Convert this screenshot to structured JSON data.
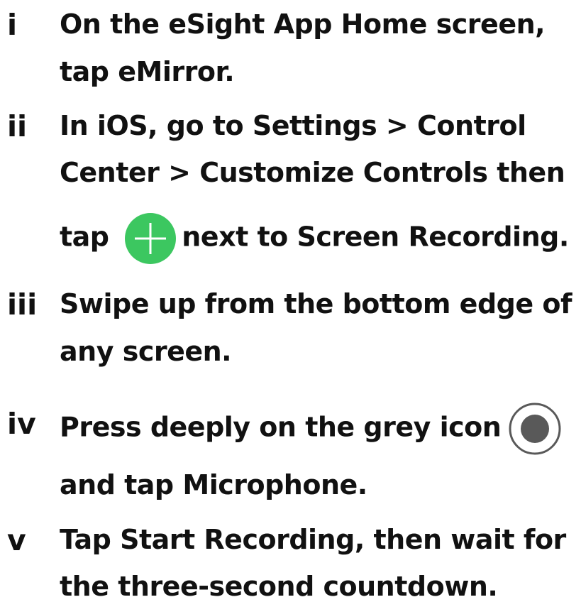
{
  "colors": {
    "text": "#111111",
    "plus_green": "#3cc760",
    "record_grey": "#595959"
  },
  "steps": [
    {
      "number": "i",
      "line1": "On the eSight App Home screen,",
      "line2_a": "tap ",
      "line2_b": "eMirror",
      "line2_c": "."
    },
    {
      "number": "ii",
      "line1_a": "In iOS, go to ",
      "line1_b": "Settings",
      "line1_c": " > ",
      "line1_d": "Control",
      "line2_a": "Center",
      "line2_b": " > ",
      "line2_c": "Customize Controls",
      "line2_d": " then",
      "line3_a": "tap",
      "line3_icon": "plus-circle-icon",
      "line3_b": "next to ",
      "line3_c": "Screen Recording",
      "line3_d": "."
    },
    {
      "number": "iii",
      "line1": "Swipe up from the bottom edge of",
      "line2": "any screen."
    },
    {
      "number": "iv",
      "line1": "Press deeply on the grey icon",
      "line1_icon": "screen-record-icon",
      "line2_a": "and tap ",
      "line2_b": "Microphone",
      "line2_c": "."
    },
    {
      "number": "v",
      "line1_a": "Tap ",
      "line1_b": "Start Recording",
      "line1_c": ", then wait for",
      "line2": "the three-second countdown."
    }
  ]
}
